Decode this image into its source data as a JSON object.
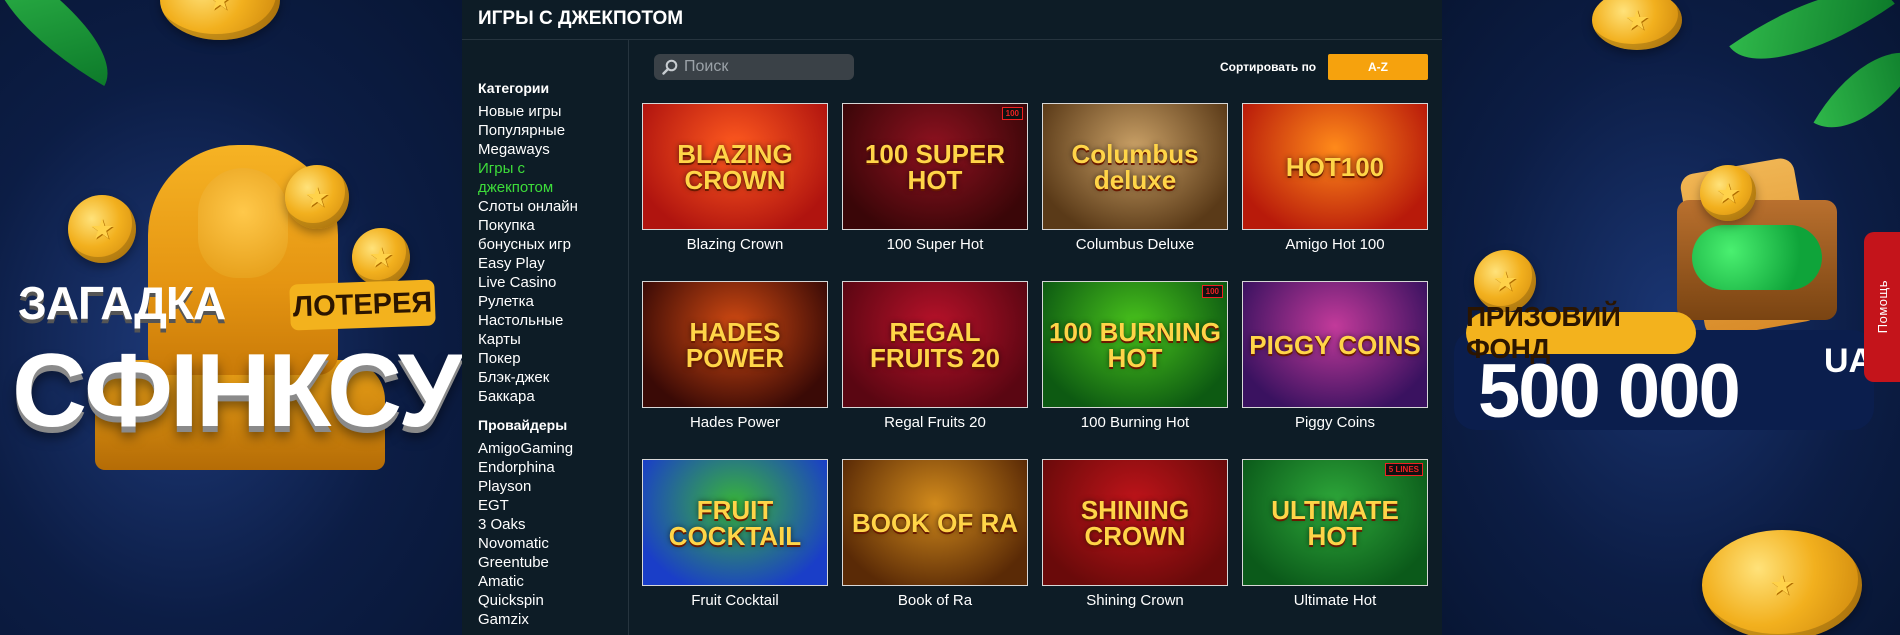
{
  "left_banner": {
    "title_line1": "ЗАГАДКА",
    "title_line2": "СФІНКСУ",
    "ribbon": "ЛОТЕРЕЯ"
  },
  "right_banner": {
    "prize_label": "ПРИЗОВИЙ ФОНД",
    "prize_amount": "500 000",
    "prize_currency": "UAH",
    "help_tab": "Помощь"
  },
  "page": {
    "title": "ИГРЫ С ДЖЕКПОТОМ"
  },
  "toolbar": {
    "search_placeholder": "Поиск",
    "sort_label": "Сортировать по",
    "sort_value": "A-Z"
  },
  "sidebar": {
    "categories_title": "Категории",
    "categories": [
      "Новые игры",
      "Популярные",
      "Megaways",
      "Игры с",
      "джекпотом",
      "Слоты онлайн",
      "Покупка",
      "бонусных игр",
      "Easy Play",
      "Live Casino",
      "Рулетка",
      "Настольные",
      "Карты",
      "Покер",
      "Блэк-джек",
      "Баккара"
    ],
    "active_category": "Игры с джекпотом",
    "providers_title": "Провайдеры",
    "providers": [
      "AmigoGaming",
      "Endorphina",
      "Playson",
      "EGT",
      "3 Oaks",
      "Novomatic",
      "Greentube",
      "Amatic",
      "Quickspin",
      "Gamzix"
    ]
  },
  "games": [
    {
      "name": "Blazing Crown",
      "art": "BLAZING CROWN",
      "bg": "#b0140f",
      "bg2": "#ff5a1f"
    },
    {
      "name": "100 Super Hot",
      "art": "100 SUPER HOT",
      "bg": "#3a0608",
      "bg2": "#8f1220",
      "badge": "100"
    },
    {
      "name": "Columbus Deluxe",
      "art": "Columbus deluxe",
      "bg": "#5a3a18",
      "bg2": "#c9a066"
    },
    {
      "name": "Amigo Hot 100",
      "art": "HOT100",
      "bg": "#b81a0a",
      "bg2": "#ff8a1a"
    },
    {
      "name": "Hades Power",
      "art": "HADES POWER",
      "bg": "#3a0a06",
      "bg2": "#d14a12"
    },
    {
      "name": "Regal Fruits 20",
      "art": "REGAL FRUITS 20",
      "bg": "#5a0612",
      "bg2": "#b8122a"
    },
    {
      "name": "100 Burning Hot",
      "art": "100 BURNING HOT",
      "bg": "#0d5a12",
      "bg2": "#49c31c",
      "badge": "100"
    },
    {
      "name": "Piggy Coins",
      "art": "PIGGY COINS",
      "bg": "#3a1260",
      "bg2": "#c23a9a"
    },
    {
      "name": "Fruit Cocktail",
      "art": "FRUIT COCKTAIL",
      "bg": "#1a3ec8",
      "bg2": "#38b43a"
    },
    {
      "name": "Book of Ra",
      "art": "BOOK OF RA",
      "bg": "#5a2a06",
      "bg2": "#d18a1c"
    },
    {
      "name": "Shining Crown",
      "art": "SHINING CROWN",
      "bg": "#6a0a0a",
      "bg2": "#c0141a"
    },
    {
      "name": "Ultimate Hot",
      "art": "ULTIMATE HOT",
      "bg": "#0b5a1a",
      "bg2": "#2ea83a",
      "badge": "5 LINES"
    }
  ],
  "colors": {
    "accent_orange": "#f6a20d",
    "active_green": "#3ddc3a",
    "panel_bg": "#0d1c26",
    "help_red": "#c4141b"
  }
}
